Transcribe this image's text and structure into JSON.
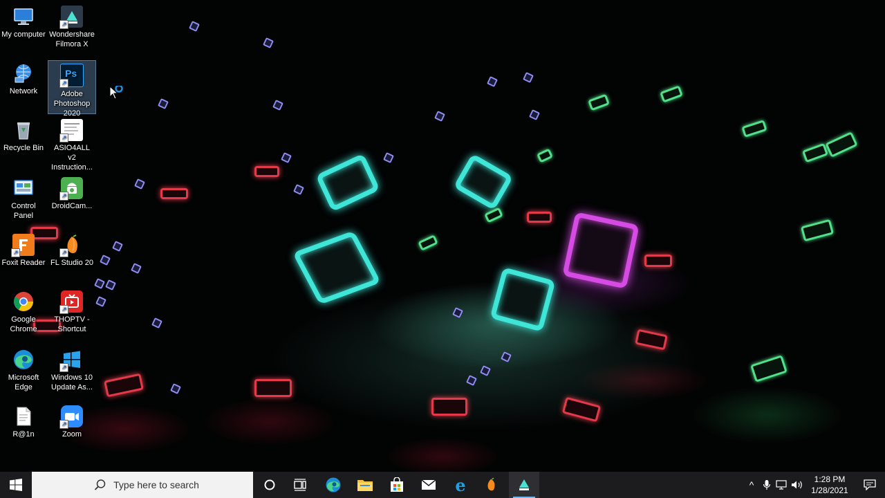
{
  "desktop": {
    "icons": [
      {
        "label": "My computer"
      },
      {
        "label": "Wondershare Filmora X"
      },
      {
        "label": "Network"
      },
      {
        "label": "Adobe Photoshop 2020"
      },
      {
        "label": "Recycle Bin"
      },
      {
        "label": "ASIO4ALL v2 Instruction..."
      },
      {
        "label": "Control Panel"
      },
      {
        "label": "DroidCam..."
      },
      {
        "label": "Foxit Reader"
      },
      {
        "label": "FL Studio 20"
      },
      {
        "label": "Google Chrome"
      },
      {
        "label": "THOPTV - Shortcut"
      },
      {
        "label": "Microsoft Edge"
      },
      {
        "label": "Windows 10 Update As..."
      },
      {
        "label": "R@1n"
      },
      {
        "label": "Zoom"
      }
    ],
    "selected_icon": "Adobe Photoshop 2020"
  },
  "taskbar": {
    "search_placeholder": "Type here to search",
    "pinned_apps": [
      "cortana",
      "task-view",
      "microsoft-edge",
      "file-explorer",
      "microsoft-store",
      "mail",
      "internet-explorer",
      "fl-studio",
      "wondershare-filmora"
    ],
    "active_app": "wondershare-filmora",
    "tray": {
      "time": "1:28 PM",
      "date": "1/28/2021",
      "show_hidden_label": "^"
    }
  },
  "colors": {
    "taskbar_bg": "#1c1c1e",
    "search_bg": "#f2f2f2",
    "accent": "#76b9ed"
  }
}
